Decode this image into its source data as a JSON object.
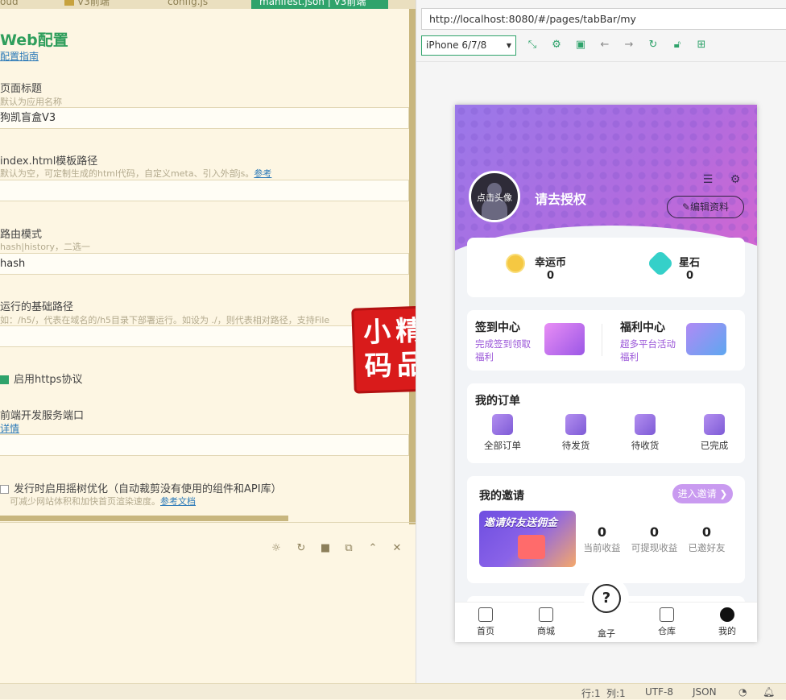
{
  "editor": {
    "tabs": [
      {
        "label": "oud"
      },
      {
        "label": "V3前端"
      },
      {
        "label": "config.js"
      },
      {
        "label": "manifest.json | V3前端"
      }
    ],
    "title": "Web配置",
    "guide_link": "配置指南",
    "fields": {
      "page_title": {
        "label": "页面标题",
        "hint": "默认为应用名称",
        "value": "狗凯盲盒V3"
      },
      "template": {
        "label": "index.html模板路径",
        "hint": "默认为空，可定制生成的html代码，自定义meta、引入外部js。",
        "hint_link": "参考",
        "value": ""
      },
      "router": {
        "label": "路由模式",
        "hint": "hash|history，二选一",
        "value": "hash"
      },
      "base_path": {
        "label": "运行的基础路径",
        "hint": "如：/h5/，代表在域名的/h5目录下部署运行。如设为 ./，则代表相对路径，支持File",
        "value": ""
      },
      "https": {
        "label": "启用https协议",
        "checked": true
      },
      "dev_port": {
        "label": "前端开发服务端口",
        "link": "详情",
        "value": ""
      },
      "treeshake": {
        "label": "发行时启用摇树优化（自动裁剪没有使用的组件和API库）",
        "hint": "可减少网站体积和加快首页渲染速度。",
        "hint_link": "参考文档",
        "checked": false
      }
    }
  },
  "seal": [
    "小",
    "精",
    "码",
    "品"
  ],
  "browser": {
    "url": "http://localhost:8080/#/pages/tabBar/my",
    "device": "iPhone 6/7/8"
  },
  "app": {
    "avatar_text": "点击头像",
    "username": "请去授权",
    "edit_label": "编辑资料",
    "coins": [
      {
        "label": "幸运币",
        "value": "0"
      },
      {
        "label": "星石",
        "value": "0"
      }
    ],
    "signin": {
      "title": "签到中心",
      "sub": "完成签到领取福利"
    },
    "welfare": {
      "title": "福利中心",
      "sub": "超多平台活动福利"
    },
    "orders": {
      "title": "我的订单",
      "items": [
        "全部订单",
        "待发货",
        "待收货",
        "已完成"
      ]
    },
    "invite": {
      "title": "我的邀请",
      "button": "进入邀请 ❯",
      "banner": "邀请好友送佣金",
      "stats": [
        {
          "value": "0",
          "label": "当前收益"
        },
        {
          "value": "0",
          "label": "可提现收益"
        },
        {
          "value": "0",
          "label": "已邀好友"
        }
      ]
    },
    "tabbar": [
      "首页",
      "商城",
      "盒子",
      "仓库",
      "我的"
    ]
  },
  "statusbar": {
    "line": "行:1",
    "col": "列:1",
    "encoding": "UTF-8",
    "language": "JSON"
  }
}
